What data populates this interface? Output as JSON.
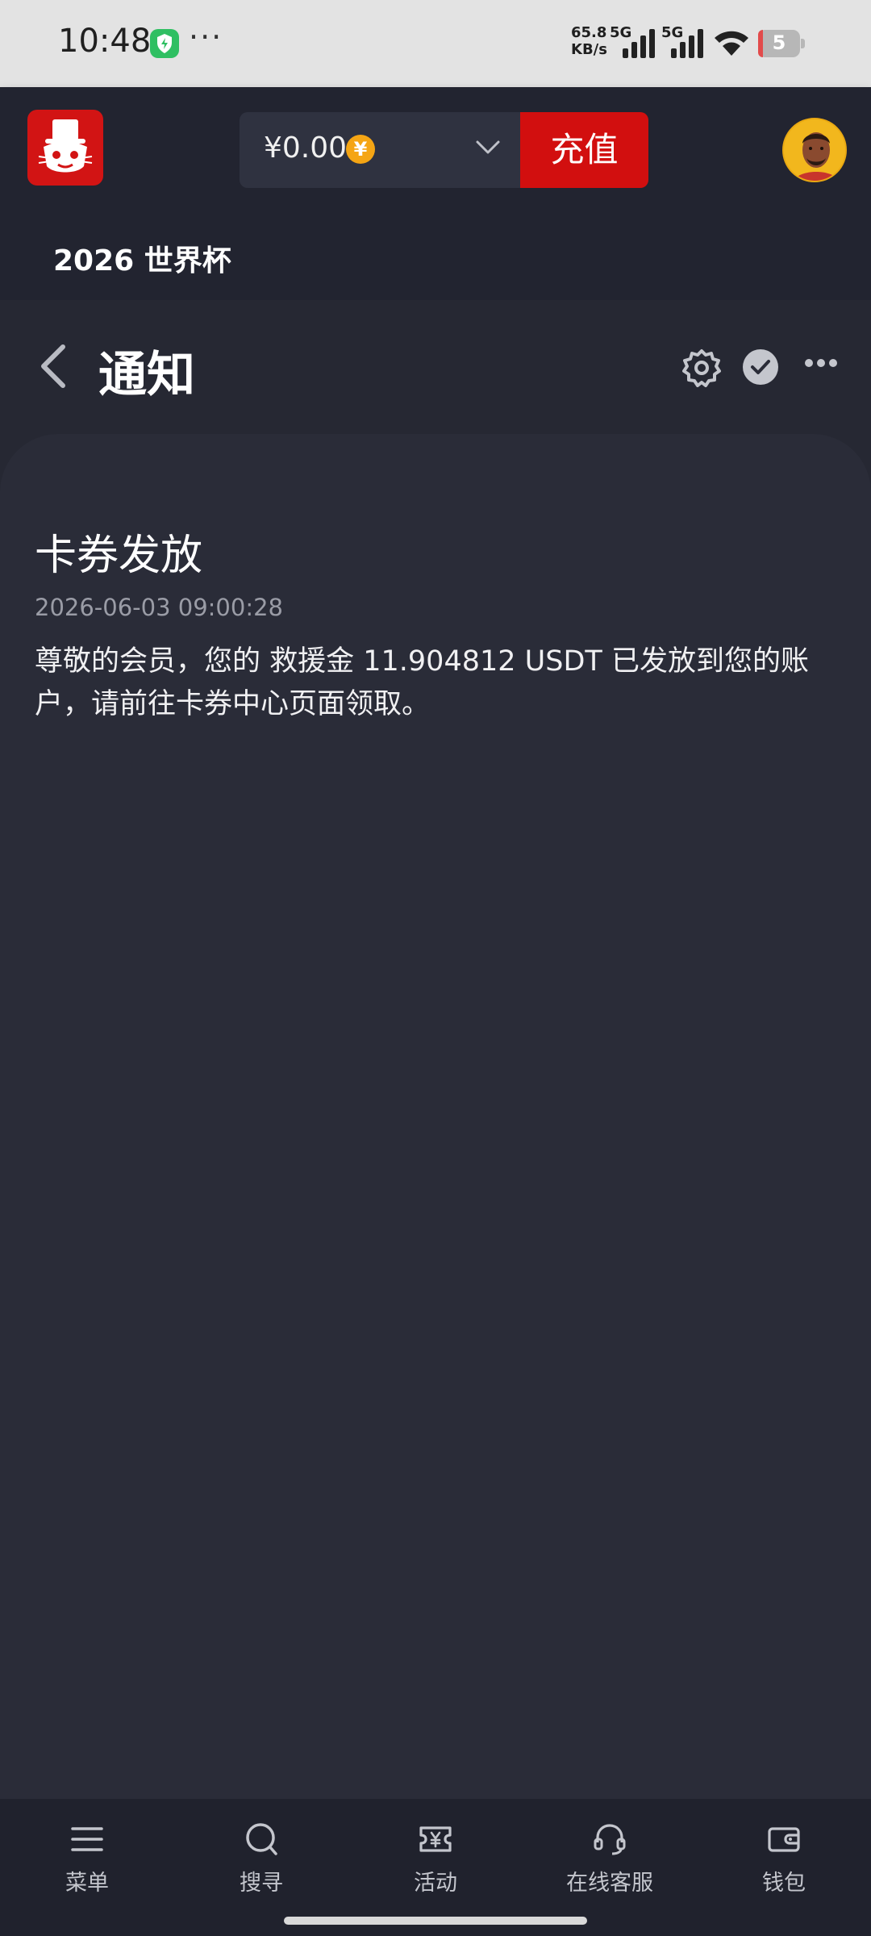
{
  "status_bar": {
    "time": "10:48",
    "speed_value": "65.8",
    "speed_unit": "KB/s",
    "network_1": "5G",
    "network_2": "5G",
    "battery": "5",
    "icons": [
      "shield-app-icon",
      "more-dots-icon",
      "signal-icon",
      "wifi-icon",
      "battery-icon"
    ]
  },
  "header": {
    "balance": "¥0.00",
    "currency_symbol": "¥",
    "recharge_label": "充值",
    "banner_text": "2026 世界杯",
    "brand_color": "#d20f0f",
    "coin_color": "#f5a514"
  },
  "titlebar": {
    "title": "通知",
    "icons": [
      "back-arrow-icon",
      "gear-icon",
      "check-circle-icon",
      "more-horizontal-icon"
    ]
  },
  "notification": {
    "title": "卡券发放",
    "timestamp": "2026-06-03 09:00:28",
    "body": "尊敬的会员，您的 救援金 11.904812 USDT 已发放到您的账户，请前往卡券中心页面领取。"
  },
  "bottom_nav": {
    "items": [
      {
        "label": "菜单",
        "icon": "menu-icon"
      },
      {
        "label": "搜寻",
        "icon": "search-icon"
      },
      {
        "label": "活动",
        "icon": "ticket-icon"
      },
      {
        "label": "在线客服",
        "icon": "headset-icon"
      },
      {
        "label": "钱包",
        "icon": "wallet-icon"
      }
    ]
  }
}
